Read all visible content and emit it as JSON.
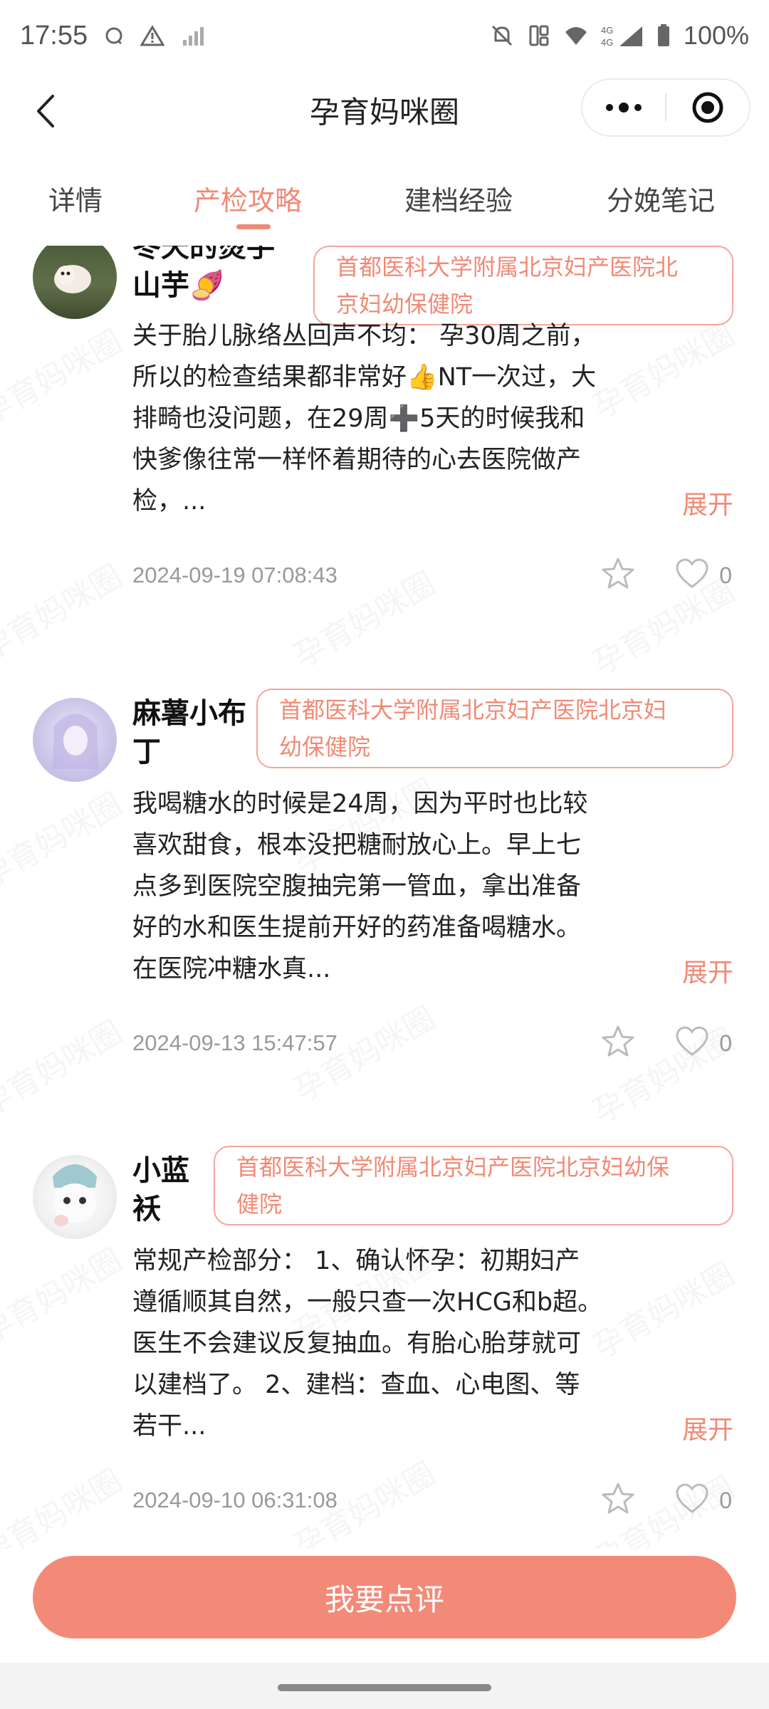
{
  "status_bar": {
    "time": "17:55",
    "battery": "100%",
    "network": "4G"
  },
  "header": {
    "title": "孕育妈咪圈",
    "back_icon": "chevron-left-icon",
    "more_icon": "more-dots-icon",
    "close_icon": "target-close-icon"
  },
  "tabs": [
    {
      "label": "详情",
      "active": false
    },
    {
      "label": "产检攻略",
      "active": true
    },
    {
      "label": "建档经验",
      "active": false
    },
    {
      "label": "分娩笔记",
      "active": false
    }
  ],
  "watermark": "孕育妈咪圈",
  "posts": [
    {
      "username_line1": "冬天的烫手",
      "username_line2": "山芋🍠",
      "hospital_line1": "首都医科大学附属北京妇产医院北",
      "hospital_line2": "京妇幼保健院",
      "content": [
        "关于胎儿脉络丛回声不均： 孕30周之前，",
        "所以的检查结果都非常好👍NT一次过，大",
        "排畸也没问题，在29周➕5天的时候我和",
        "快爹像往常一样怀着期待的心去医院做产",
        "检，..."
      ],
      "expand": "展开",
      "date": "2024-09-19 07:08:43",
      "likes": "0"
    },
    {
      "username_line1": "麻薯小布",
      "username_line2": "丁",
      "hospital_line1": "首都医科大学附属北京妇产医院北京妇",
      "hospital_line2": "幼保健院",
      "content": [
        "我喝糖水的时候是24周，因为平时也比较",
        "喜欢甜食，根本没把糖耐放心上。早上七",
        "点多到医院空腹抽完第一管血，拿出准备",
        "好的水和医生提前开好的药准备喝糖水。",
        "在医院冲糖水真..."
      ],
      "expand": "展开",
      "date": "2024-09-13 15:47:57",
      "likes": "0"
    },
    {
      "username_line1": "小蓝",
      "username_line2": "袄",
      "hospital_line1": "首都医科大学附属北京妇产医院北京妇幼保",
      "hospital_line2": "健院",
      "content": [
        "常规产检部分： 1、确认怀孕：初期妇产",
        "遵循顺其自然，一般只查一次HCG和b超。",
        "医生不会建议反复抽血。有胎心胎芽就可",
        "以建档了。 2、建档：查血、心电图、等",
        "若干..."
      ],
      "expand": "展开",
      "date": "2024-09-10 06:31:08",
      "likes": "0"
    }
  ],
  "bottom": {
    "review_button": "我要点评"
  },
  "colors": {
    "accent": "#f08a76",
    "button": "#f38a78",
    "tag_border": "#f3a79a"
  }
}
